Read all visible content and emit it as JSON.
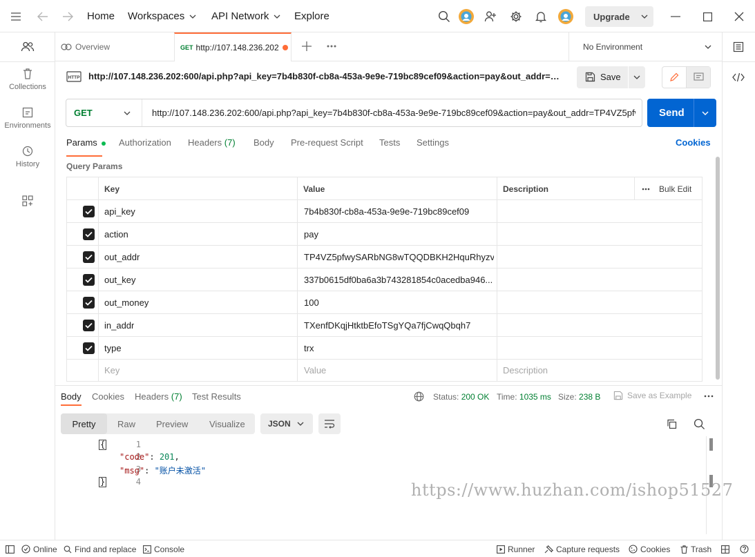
{
  "topbar": {
    "home": "Home",
    "workspaces": "Workspaces",
    "api_network": "API Network",
    "explore": "Explore",
    "upgrade": "Upgrade"
  },
  "sidebar": {
    "items": [
      {
        "label": "Collections"
      },
      {
        "label": "Environments"
      },
      {
        "label": "History"
      }
    ]
  },
  "tabs": {
    "overview": "Overview",
    "active_method": "GET",
    "active_url": "http://107.148.236.202",
    "environment": "No Environment"
  },
  "request": {
    "title": "http://107.148.236.202:600/api.php?api_key=7b4b830f-cb8a-453a-9e9e-719bc89cef09&action=pay&out_addr=T...",
    "save_label": "Save",
    "method": "GET",
    "url": "http://107.148.236.202:600/api.php?api_key=7b4b830f-cb8a-453a-9e9e-719bc89cef09&action=pay&out_addr=TP4VZ5pfw",
    "send_label": "Send"
  },
  "request_tabs": {
    "params": "Params",
    "authorization": "Authorization",
    "headers": "Headers",
    "headers_count": "(7)",
    "body": "Body",
    "prerequest": "Pre-request Script",
    "tests": "Tests",
    "settings": "Settings",
    "cookies": "Cookies"
  },
  "params": {
    "section_title": "Query Params",
    "columns": {
      "key": "Key",
      "value": "Value",
      "description": "Description",
      "bulk_edit": "Bulk Edit"
    },
    "rows": [
      {
        "key": "api_key",
        "value": "7b4b830f-cb8a-453a-9e9e-719bc89cef09"
      },
      {
        "key": "action",
        "value": "pay"
      },
      {
        "key": "out_addr",
        "value": "TP4VZ5pfwySARbNG8wTQQDBKH2HquRhyzv"
      },
      {
        "key": "out_key",
        "value": "337b0615df0ba6a3b743281854c0acedba946..."
      },
      {
        "key": "out_money",
        "value": "100"
      },
      {
        "key": "in_addr",
        "value": "TXenfDKqjHtktbEfoTSgYQa7fjCwqQbqh7"
      },
      {
        "key": "type",
        "value": "trx"
      }
    ],
    "placeholder": {
      "key": "Key",
      "value": "Value",
      "description": "Description"
    }
  },
  "response": {
    "tabs": {
      "body": "Body",
      "cookies": "Cookies",
      "headers": "Headers",
      "headers_count": "(7)",
      "test_results": "Test Results"
    },
    "status_label": "Status:",
    "status_value": "200 OK",
    "time_label": "Time:",
    "time_value": "1035 ms",
    "size_label": "Size:",
    "size_value": "238 B",
    "save_example": "Save as Example",
    "views": {
      "pretty": "Pretty",
      "raw": "Raw",
      "preview": "Preview",
      "visualize": "Visualize"
    },
    "format": "JSON",
    "code": {
      "lines": [
        "1",
        "2",
        "3",
        "4"
      ],
      "open": "{",
      "key1": "\"code\"",
      "val1": "201",
      "key2": "\"msg\"",
      "val2": "\"账户未激活\"",
      "close": "}"
    }
  },
  "watermark": "https://www.huzhan.com/ishop51527",
  "footer": {
    "online": "Online",
    "find_replace": "Find and replace",
    "console": "Console",
    "runner": "Runner",
    "capture": "Capture requests",
    "cookies": "Cookies",
    "trash": "Trash"
  },
  "colors": {
    "accent": "#ff6c37",
    "send": "#0265d2",
    "method_get": "#007f31",
    "status_ok": "#007f31"
  }
}
